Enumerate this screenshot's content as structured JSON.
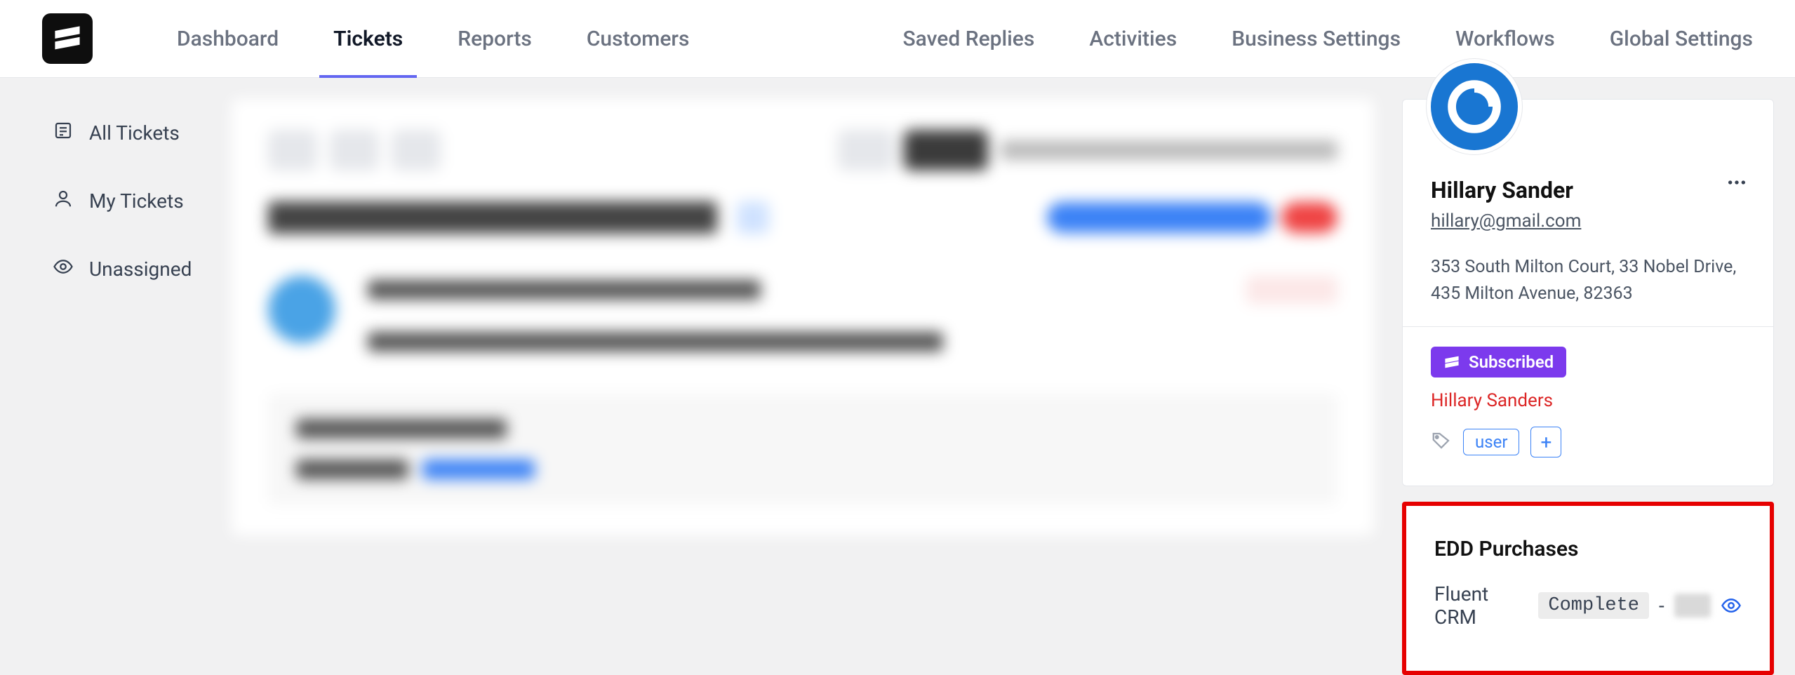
{
  "nav": {
    "left": [
      {
        "label": "Dashboard",
        "active": false
      },
      {
        "label": "Tickets",
        "active": true
      },
      {
        "label": "Reports",
        "active": false
      },
      {
        "label": "Customers",
        "active": false
      }
    ],
    "right": [
      {
        "label": "Saved Replies"
      },
      {
        "label": "Activities"
      },
      {
        "label": "Business Settings"
      },
      {
        "label": "Workflows"
      },
      {
        "label": "Global Settings"
      }
    ]
  },
  "sidebar": {
    "items": [
      {
        "label": "All Tickets",
        "icon": "list"
      },
      {
        "label": "My Tickets",
        "icon": "user"
      },
      {
        "label": "Unassigned",
        "icon": "eye"
      }
    ]
  },
  "profile": {
    "name": "Hillary Sander",
    "email": "hillary@gmail.com",
    "address": "353 South Milton Court, 33 Nobel Drive, 435 Milton Avenue, 82363",
    "subscribed_label": "Subscribed",
    "crm_name": "Hillary Sanders",
    "tags": [
      "user"
    ]
  },
  "purchases": {
    "title": "EDD Purchases",
    "items": [
      {
        "product": "Fluent CRM",
        "status": "Complete"
      }
    ]
  }
}
